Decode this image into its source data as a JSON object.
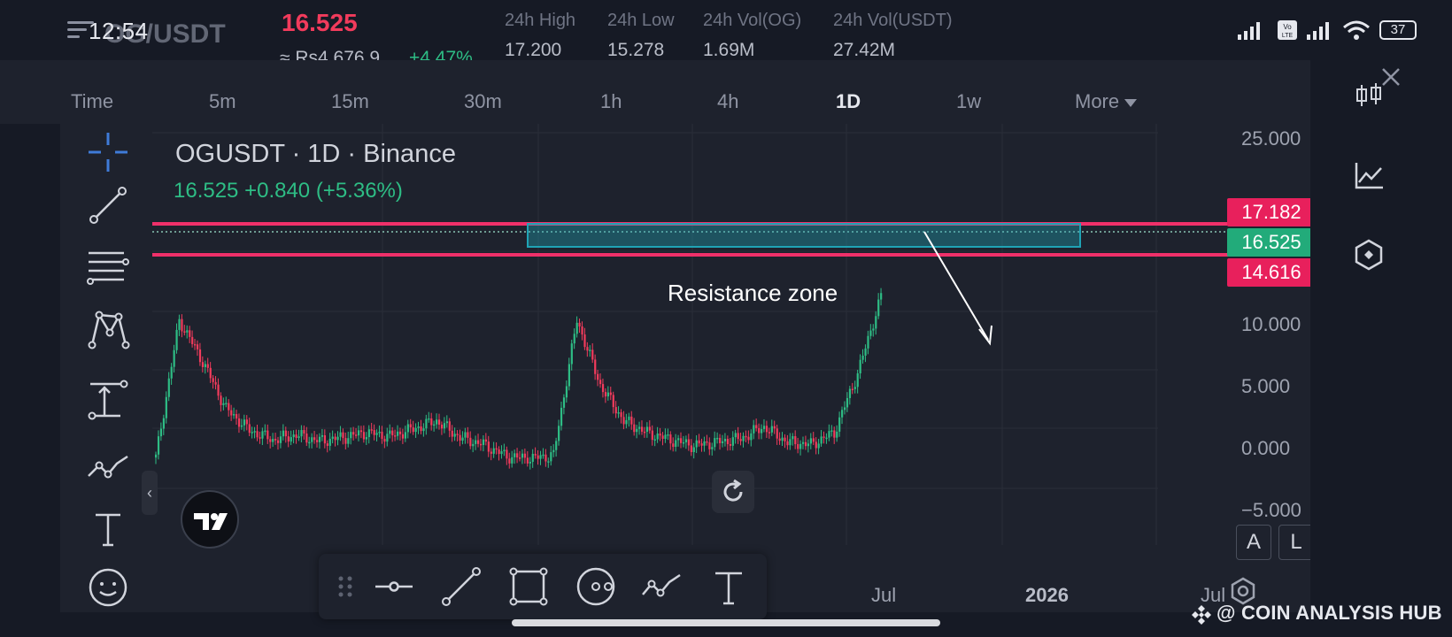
{
  "status_bar": {
    "time": "12:54",
    "battery": "37"
  },
  "header": {
    "pair": "OG/USDT",
    "last_price": "16.525",
    "fiat_price": "≈ Rs4,676.9",
    "change_pct": "+4.47%",
    "stats": [
      {
        "label": "24h High",
        "value": "17.200"
      },
      {
        "label": "24h Low",
        "value": "15.278"
      },
      {
        "label": "24h Vol(OG)",
        "value": "1.69M"
      },
      {
        "label": "24h Vol(USDT)",
        "value": "27.42M"
      }
    ]
  },
  "timeframes": {
    "items": [
      "Time",
      "5m",
      "15m",
      "30m",
      "1h",
      "4h",
      "1D",
      "1w",
      "More"
    ],
    "active": "1D"
  },
  "chart": {
    "title": "OGUSDT · 1D · Binance",
    "ohlc": "16.525  +0.840 (+5.36%)",
    "annotation": "Resistance zone",
    "price_tags": {
      "upper": "17.182",
      "current": "16.525",
      "lower": "14.616"
    },
    "colors": {
      "up": "#2ebd85",
      "down": "#f23b5c",
      "zone_line": "#f0306a",
      "box": "#1fa3b5"
    },
    "buttons": {
      "auto": "A",
      "log": "L"
    }
  },
  "chart_data": {
    "type": "candlestick",
    "title": "OGUSDT · 1D · Binance",
    "y_ticks": [
      "25.000",
      "10.000",
      "5.000",
      "0.000",
      "−5.000"
    ],
    "x_ticks": [
      "Jul",
      "2026",
      "Jul"
    ],
    "ylim": [
      -5,
      25
    ],
    "series": [
      {
        "name": "close",
        "values": [
          2.9,
          14.5,
          11.0,
          7.0,
          5.2,
          4.4,
          4.8,
          4.3,
          4.6,
          5.0,
          4.7,
          5.3,
          6.0,
          4.6,
          4.0,
          3.0,
          2.8,
          3.1,
          14.5,
          9.0,
          6.0,
          5.0,
          4.4,
          3.9,
          4.2,
          4.5,
          5.5,
          4.2,
          4.0,
          5.0,
          10.0,
          16.5
        ]
      }
    ],
    "horizontal_lines": [
      17.182,
      16.525,
      14.616
    ]
  },
  "watermark": "@ COIN ANALYSIS HUB"
}
